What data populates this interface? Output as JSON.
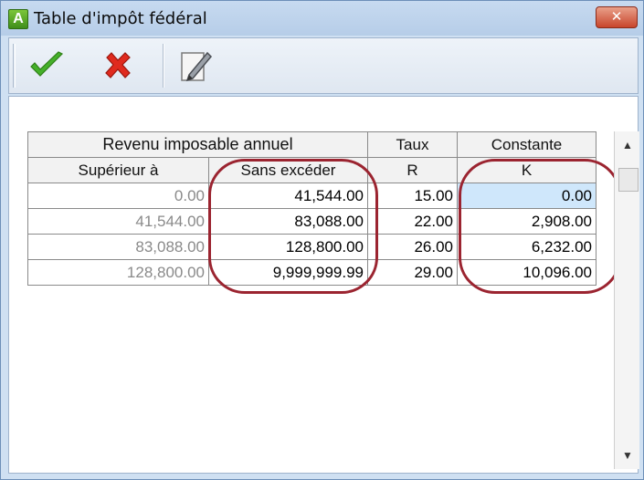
{
  "window": {
    "title": "Table d'impôt fédéral",
    "app_icon_letter": "A",
    "close_label": "✕"
  },
  "toolbar": {
    "ok_icon": "check-icon",
    "cancel_icon": "x-icon",
    "edit_icon": "pencil-icon"
  },
  "table": {
    "group_header": "Revenu imposable annuel",
    "headers": {
      "rate_top": "Taux",
      "constant_top": "Constante",
      "col1": "Supérieur à",
      "col2": "Sans excéder",
      "col3": "R",
      "col4": "K"
    },
    "rows": [
      {
        "superieur": "0.00",
        "sans_exceder": "41,544.00",
        "taux": "15.00",
        "constante": "0.00"
      },
      {
        "superieur": "41,544.00",
        "sans_exceder": "83,088.00",
        "taux": "22.00",
        "constante": "2,908.00"
      },
      {
        "superieur": "83,088.00",
        "sans_exceder": "128,800.00",
        "taux": "26.00",
        "constante": "6,232.00"
      },
      {
        "superieur": "128,800.00",
        "sans_exceder": "9,999,999.99",
        "taux": "29.00",
        "constante": "10,096.00"
      }
    ]
  },
  "colors": {
    "highlight": "#9b2430",
    "selected_cell": "#cfe7fb",
    "ok_green": "#45b02a",
    "cancel_red": "#e02a1e"
  }
}
